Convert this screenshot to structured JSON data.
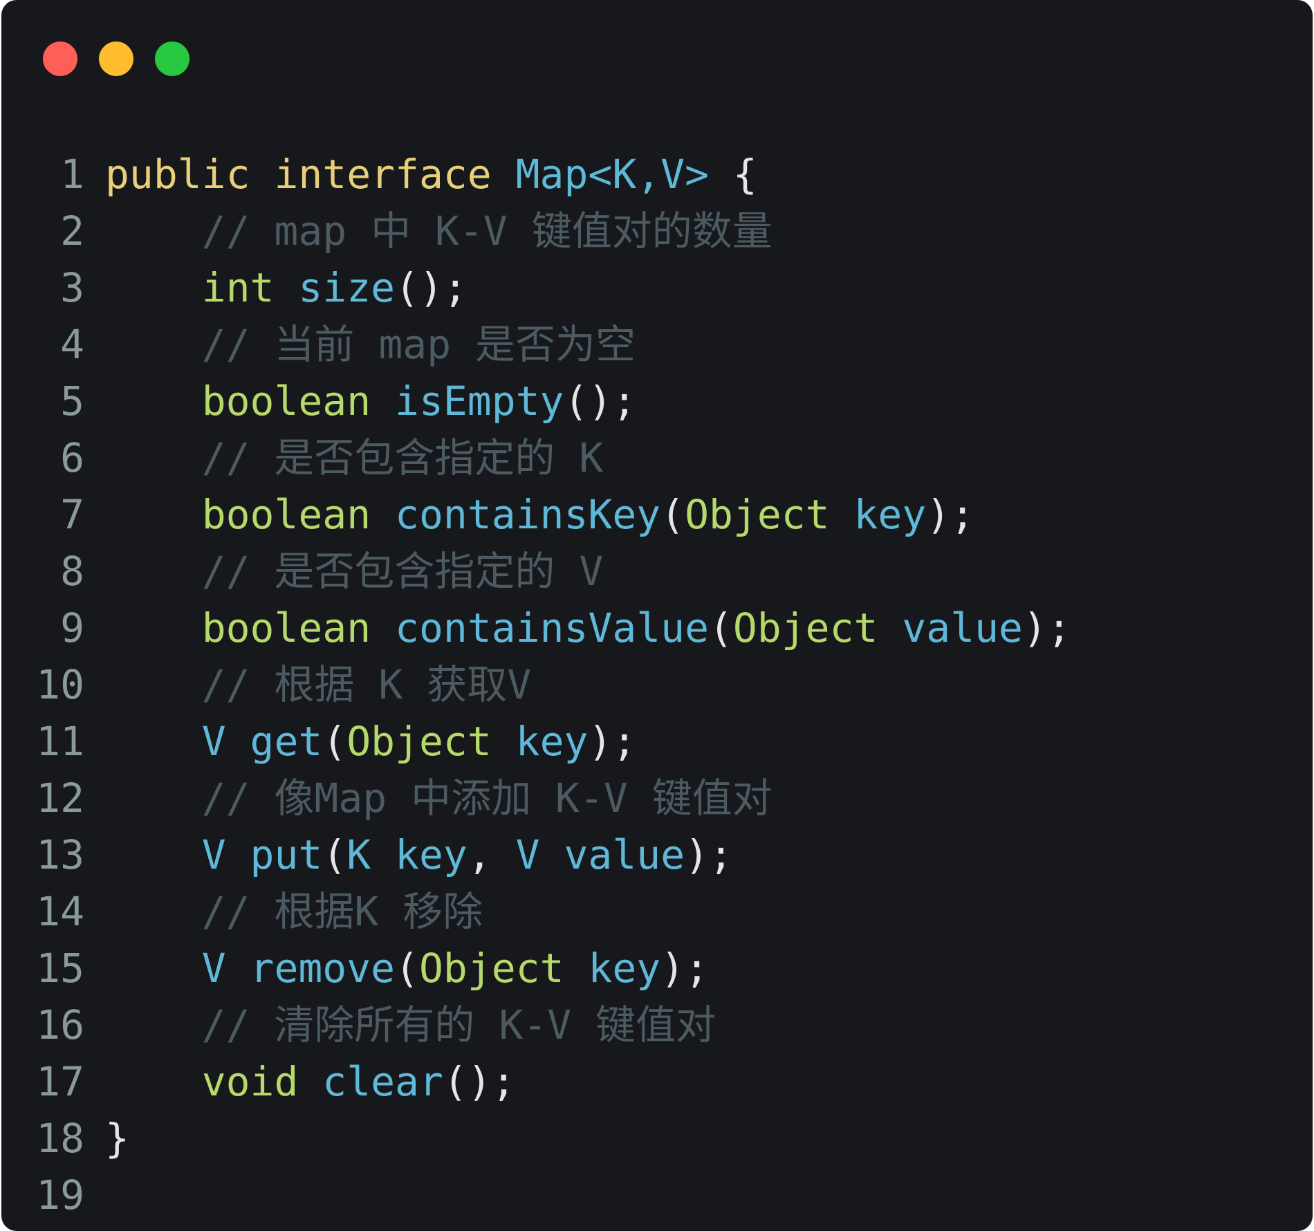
{
  "colors": {
    "window_bg": "#16181b",
    "traffic_red": "#ff5f57",
    "traffic_yellow": "#febc2e",
    "traffic_green": "#28c840",
    "line_number": "#8a9a9a",
    "keyword_decl": "#e9cf7a",
    "keyword_type": "#b5d96b",
    "identifier": "#5fb8d8",
    "comment": "#4c5a62",
    "punctuation": "#e6e6e6"
  },
  "window_controls": [
    "close",
    "minimize",
    "zoom"
  ],
  "code_lines": [
    {
      "number": "1",
      "tokens": [
        {
          "t": "public",
          "c": "keyword_decl"
        },
        {
          "t": " ",
          "c": "punctuation"
        },
        {
          "t": "interface",
          "c": "keyword_decl"
        },
        {
          "t": " ",
          "c": "punctuation"
        },
        {
          "t": "Map<K,V>",
          "c": "identifier"
        },
        {
          "t": " {",
          "c": "punctuation"
        }
      ]
    },
    {
      "number": "2",
      "tokens": [
        {
          "t": "    // map 中 K-V 键值对的数量",
          "c": "comment"
        }
      ]
    },
    {
      "number": "3",
      "tokens": [
        {
          "t": "    ",
          "c": "punctuation"
        },
        {
          "t": "int",
          "c": "keyword_type"
        },
        {
          "t": " ",
          "c": "punctuation"
        },
        {
          "t": "size",
          "c": "identifier"
        },
        {
          "t": "();",
          "c": "punctuation"
        }
      ]
    },
    {
      "number": "4",
      "tokens": [
        {
          "t": "    // 当前 map 是否为空",
          "c": "comment"
        }
      ]
    },
    {
      "number": "5",
      "tokens": [
        {
          "t": "    ",
          "c": "punctuation"
        },
        {
          "t": "boolean",
          "c": "keyword_type"
        },
        {
          "t": " ",
          "c": "punctuation"
        },
        {
          "t": "isEmpty",
          "c": "identifier"
        },
        {
          "t": "();",
          "c": "punctuation"
        }
      ]
    },
    {
      "number": "6",
      "tokens": [
        {
          "t": "    // 是否包含指定的 K",
          "c": "comment"
        }
      ]
    },
    {
      "number": "7",
      "tokens": [
        {
          "t": "    ",
          "c": "punctuation"
        },
        {
          "t": "boolean",
          "c": "keyword_type"
        },
        {
          "t": " ",
          "c": "punctuation"
        },
        {
          "t": "containsKey",
          "c": "identifier"
        },
        {
          "t": "(",
          "c": "punctuation"
        },
        {
          "t": "Object",
          "c": "keyword_type"
        },
        {
          "t": " ",
          "c": "punctuation"
        },
        {
          "t": "key",
          "c": "identifier"
        },
        {
          "t": ");",
          "c": "punctuation"
        }
      ]
    },
    {
      "number": "8",
      "tokens": [
        {
          "t": "    // 是否包含指定的 V",
          "c": "comment"
        }
      ]
    },
    {
      "number": "9",
      "tokens": [
        {
          "t": "    ",
          "c": "punctuation"
        },
        {
          "t": "boolean",
          "c": "keyword_type"
        },
        {
          "t": " ",
          "c": "punctuation"
        },
        {
          "t": "containsValue",
          "c": "identifier"
        },
        {
          "t": "(",
          "c": "punctuation"
        },
        {
          "t": "Object",
          "c": "keyword_type"
        },
        {
          "t": " ",
          "c": "punctuation"
        },
        {
          "t": "value",
          "c": "identifier"
        },
        {
          "t": ");",
          "c": "punctuation"
        }
      ]
    },
    {
      "number": "10",
      "tokens": [
        {
          "t": "    // 根据 K 获取V",
          "c": "comment"
        }
      ]
    },
    {
      "number": "11",
      "tokens": [
        {
          "t": "    ",
          "c": "punctuation"
        },
        {
          "t": "V",
          "c": "identifier"
        },
        {
          "t": " ",
          "c": "punctuation"
        },
        {
          "t": "get",
          "c": "identifier"
        },
        {
          "t": "(",
          "c": "punctuation"
        },
        {
          "t": "Object",
          "c": "keyword_type"
        },
        {
          "t": " ",
          "c": "punctuation"
        },
        {
          "t": "key",
          "c": "identifier"
        },
        {
          "t": ");",
          "c": "punctuation"
        }
      ]
    },
    {
      "number": "12",
      "tokens": [
        {
          "t": "    // 像Map 中添加 K-V 键值对",
          "c": "comment"
        }
      ]
    },
    {
      "number": "13",
      "tokens": [
        {
          "t": "    ",
          "c": "punctuation"
        },
        {
          "t": "V",
          "c": "identifier"
        },
        {
          "t": " ",
          "c": "punctuation"
        },
        {
          "t": "put",
          "c": "identifier"
        },
        {
          "t": "(",
          "c": "punctuation"
        },
        {
          "t": "K",
          "c": "identifier"
        },
        {
          "t": " ",
          "c": "punctuation"
        },
        {
          "t": "key",
          "c": "identifier"
        },
        {
          "t": ", ",
          "c": "punctuation"
        },
        {
          "t": "V",
          "c": "identifier"
        },
        {
          "t": " ",
          "c": "punctuation"
        },
        {
          "t": "value",
          "c": "identifier"
        },
        {
          "t": ");",
          "c": "punctuation"
        }
      ]
    },
    {
      "number": "14",
      "tokens": [
        {
          "t": "    // 根据K 移除",
          "c": "comment"
        }
      ]
    },
    {
      "number": "15",
      "tokens": [
        {
          "t": "    ",
          "c": "punctuation"
        },
        {
          "t": "V",
          "c": "identifier"
        },
        {
          "t": " ",
          "c": "punctuation"
        },
        {
          "t": "remove",
          "c": "identifier"
        },
        {
          "t": "(",
          "c": "punctuation"
        },
        {
          "t": "Object",
          "c": "keyword_type"
        },
        {
          "t": " ",
          "c": "punctuation"
        },
        {
          "t": "key",
          "c": "identifier"
        },
        {
          "t": ");",
          "c": "punctuation"
        }
      ]
    },
    {
      "number": "16",
      "tokens": [
        {
          "t": "    // 清除所有的 K-V 键值对",
          "c": "comment"
        }
      ]
    },
    {
      "number": "17",
      "tokens": [
        {
          "t": "    ",
          "c": "punctuation"
        },
        {
          "t": "void",
          "c": "keyword_type"
        },
        {
          "t": " ",
          "c": "punctuation"
        },
        {
          "t": "clear",
          "c": "identifier"
        },
        {
          "t": "();",
          "c": "punctuation"
        }
      ]
    },
    {
      "number": "18",
      "tokens": [
        {
          "t": "}",
          "c": "punctuation"
        }
      ]
    },
    {
      "number": "19",
      "tokens": []
    }
  ]
}
